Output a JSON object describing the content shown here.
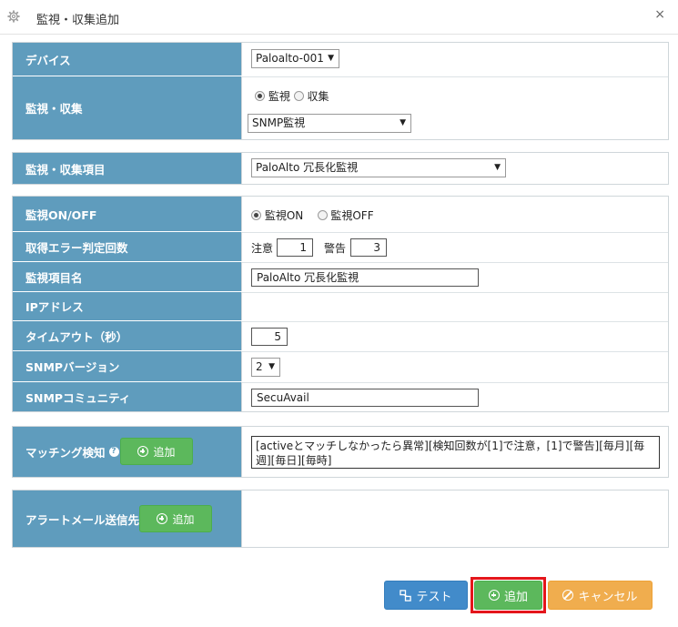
{
  "dialog": {
    "title": "監視・収集追加",
    "close_label": "×",
    "settings_icon": "gear-icon"
  },
  "device": {
    "label": "デバイス",
    "value": "Paloalto-001"
  },
  "monitor_collect": {
    "label": "監視・収集",
    "radio_monitor": "監視",
    "radio_collect": "収集",
    "selected": "監視",
    "type_value": "SNMP監視"
  },
  "item": {
    "label": "監視・収集項目",
    "value": "PaloAlto 冗長化監視"
  },
  "settings": {
    "onoff_label": "監視ON/OFF",
    "on_label": "監視ON",
    "off_label": "監視OFF",
    "onoff_selected": "監視ON",
    "error_label": "取得エラー判定回数",
    "caution_label": "注意",
    "caution_value": "1",
    "warning_label": "警告",
    "warning_value": "3",
    "name_label": "監視項目名",
    "name_value": "PaloAlto 冗長化監視",
    "ip_label": "IPアドレス",
    "ip_value": "",
    "timeout_label": "タイムアウト（秒）",
    "timeout_value": "5",
    "snmp_version_label": "SNMPバージョン",
    "snmp_version_value": "2",
    "community_label": "SNMPコミュニティ",
    "community_value": "SecuAvail"
  },
  "matching": {
    "label": "マッチング検知",
    "help_icon": "?",
    "add_label": "追加",
    "rule_text": "[activeとマッチしなかったら異常][検知回数が[1]で注意，[1]で警告][毎月][毎週][毎日][毎時]"
  },
  "alert_mail": {
    "label": "アラートメール送信先",
    "add_label": "追加"
  },
  "footer": {
    "test_label": "テスト",
    "add_label": "追加",
    "cancel_label": "キャンセル"
  },
  "colors": {
    "label_bg": "#5f9cbd",
    "add_green": "#5cb85c",
    "test_blue": "#428bca",
    "cancel_orange": "#f0ad4e",
    "highlight_red": "#e4161b"
  }
}
